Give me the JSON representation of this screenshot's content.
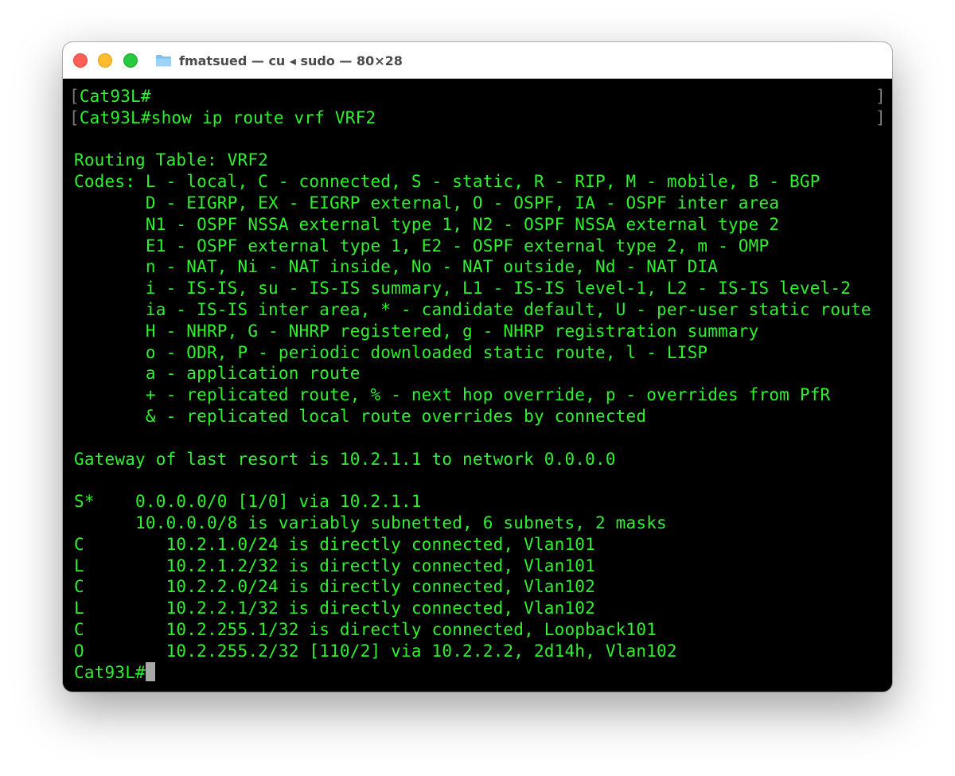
{
  "window": {
    "title": "fmatsued — cu ◂ sudo — 80×28"
  },
  "colors": {
    "terminal_bg": "#000000",
    "terminal_fg": "#2ff22f",
    "close": "#ff5f57",
    "minimize": "#febc2e",
    "zoom": "#28c840"
  },
  "terminal": {
    "history": [
      "Cat93L#",
      "Cat93L#show ip route vrf VRF2"
    ],
    "lines": [
      "",
      "Routing Table: VRF2",
      "Codes: L - local, C - connected, S - static, R - RIP, M - mobile, B - BGP",
      "       D - EIGRP, EX - EIGRP external, O - OSPF, IA - OSPF inter area",
      "       N1 - OSPF NSSA external type 1, N2 - OSPF NSSA external type 2",
      "       E1 - OSPF external type 1, E2 - OSPF external type 2, m - OMP",
      "       n - NAT, Ni - NAT inside, No - NAT outside, Nd - NAT DIA",
      "       i - IS-IS, su - IS-IS summary, L1 - IS-IS level-1, L2 - IS-IS level-2",
      "       ia - IS-IS inter area, * - candidate default, U - per-user static route",
      "       H - NHRP, G - NHRP registered, g - NHRP registration summary",
      "       o - ODR, P - periodic downloaded static route, l - LISP",
      "       a - application route",
      "       + - replicated route, % - next hop override, p - overrides from PfR",
      "       & - replicated local route overrides by connected",
      "",
      "Gateway of last resort is 10.2.1.1 to network 0.0.0.0",
      "",
      "S*    0.0.0.0/0 [1/0] via 10.2.1.1",
      "      10.0.0.0/8 is variably subnetted, 6 subnets, 2 masks",
      "C        10.2.1.0/24 is directly connected, Vlan101",
      "L        10.2.1.2/32 is directly connected, Vlan101",
      "C        10.2.2.0/24 is directly connected, Vlan102",
      "L        10.2.2.1/32 is directly connected, Vlan102",
      "C        10.2.255.1/32 is directly connected, Loopback101",
      "O        10.2.255.2/32 [110/2] via 10.2.2.2, 2d14h, Vlan102"
    ],
    "prompt": "Cat93L#"
  }
}
